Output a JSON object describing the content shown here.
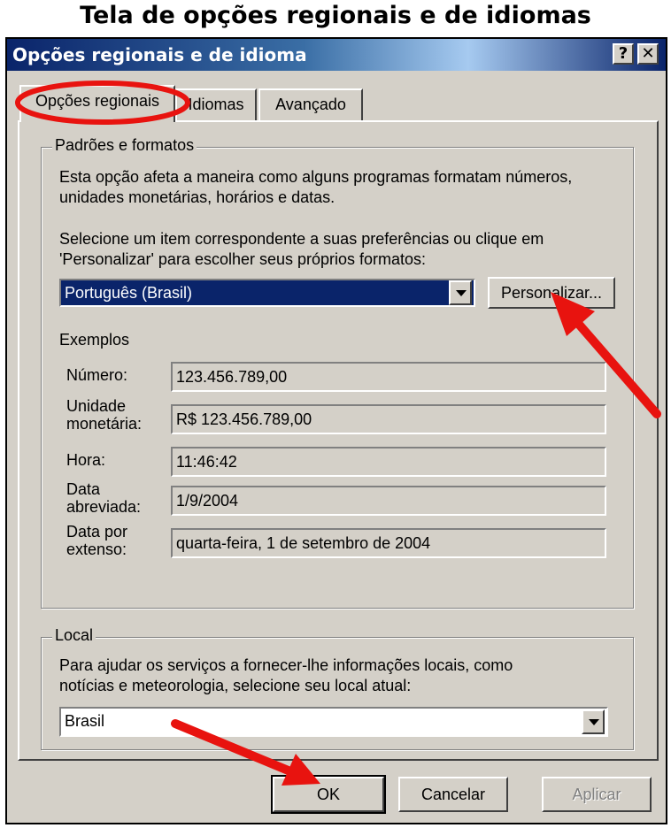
{
  "caption": "Tela de opções regionais e de idiomas",
  "window": {
    "title": "Opções regionais e de idioma",
    "help_label": "?",
    "close_label": "✕"
  },
  "tabs": [
    {
      "label": "Opções regionais",
      "active": true
    },
    {
      "label": "Idiomas",
      "active": false
    },
    {
      "label": "Avançado",
      "active": false
    }
  ],
  "standards": {
    "legend": "Padrões e formatos",
    "description": [
      "Esta opção afeta a maneira como alguns programas formatam números,",
      "unidades monetárias, horários e datas."
    ],
    "instruction": [
      "Selecione um item correspondente a suas preferências ou clique em",
      "'Personalizar' para escolher seus próprios formatos:"
    ],
    "selected_locale": "Português (Brasil)",
    "customize_label": "Personalizar...",
    "examples_heading": "Exemplos",
    "examples": [
      {
        "label": [
          "Número:"
        ],
        "value": "123.456.789,00"
      },
      {
        "label": [
          "Unidade",
          "monetária:"
        ],
        "value": "R$ 123.456.789,00"
      },
      {
        "label": [
          "Hora:"
        ],
        "value": "11:46:42"
      },
      {
        "label": [
          "Data",
          "abreviada:"
        ],
        "value": "1/9/2004"
      },
      {
        "label": [
          "Data por",
          "extenso:"
        ],
        "value": "quarta-feira, 1 de setembro de 2004"
      }
    ]
  },
  "location": {
    "legend": "Local",
    "description": [
      "Para ajudar os serviços a fornecer-lhe informações locais, como",
      "notícias e meteorologia, selecione seu local atual:"
    ],
    "selected": "Brasil"
  },
  "buttons": {
    "ok": "OK",
    "cancel": "Cancelar",
    "apply": "Aplicar"
  },
  "colors": {
    "annotation": "#e8130f",
    "title_bar": "#0a246a",
    "selection": "#0a246a"
  }
}
